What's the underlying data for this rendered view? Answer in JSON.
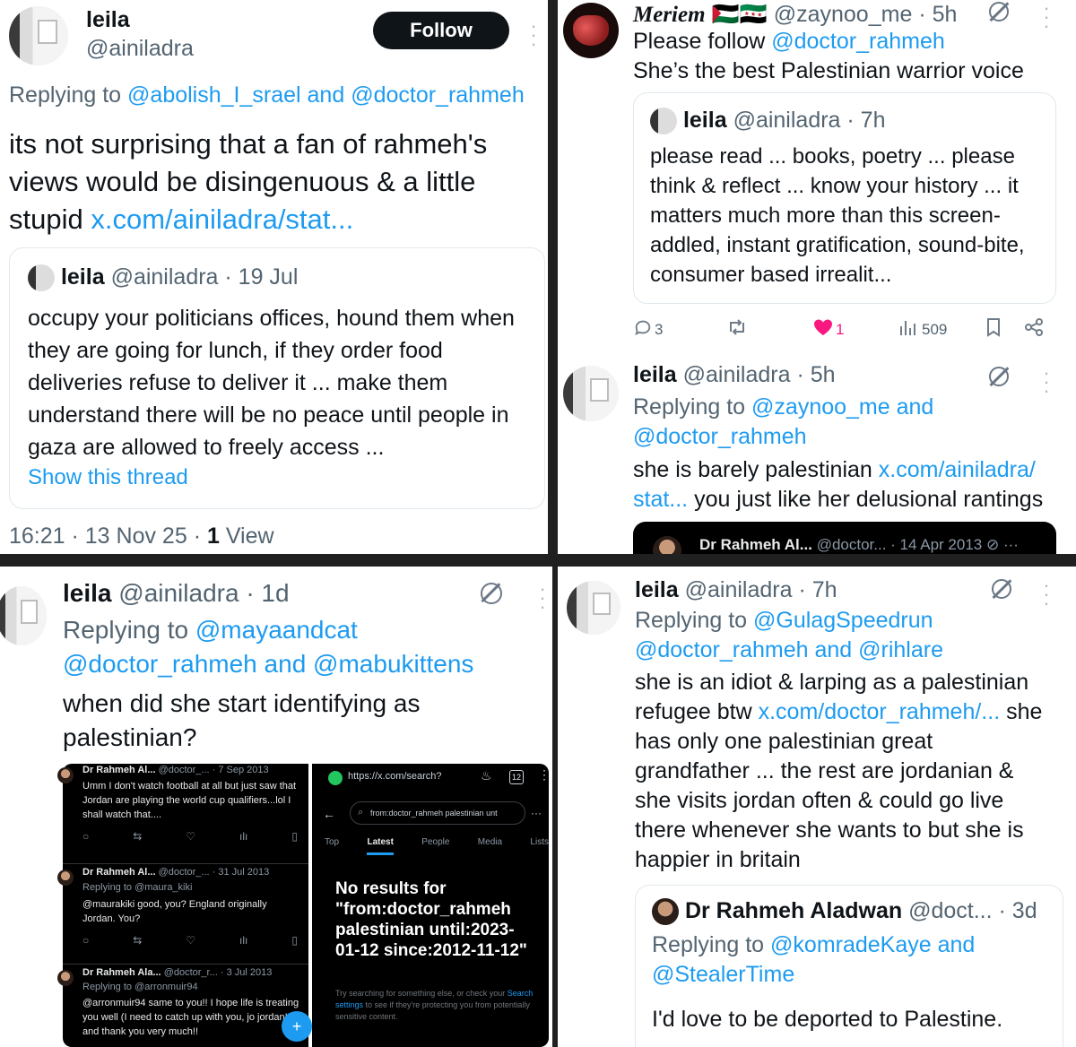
{
  "panel1": {
    "author_name": "leila",
    "author_handle": "@ainiladra",
    "follow_label": "Follow",
    "reply_prefix": "Replying to ",
    "reply_to_1": "@abolish_I_srael",
    "reply_and": " and ",
    "reply_to_2": "@doctor_rahmeh",
    "body": "its not surprising that a fan of rahmeh's views would be disingenuous & a little stupid ",
    "body_link": "x.com/ainiladra/stat...",
    "quote": {
      "author_name": "leila",
      "author_handle": "@ainiladra",
      "date": "· 19 Jul",
      "text": "occupy your politicians offices, hound them when they are going for lunch, if they order food deliveries refuse to deliver it ... make them understand there will be no peace until people in gaza are allowed to freely access ...",
      "show_thread": "Show this thread"
    },
    "timestamp": "16:21 · 13 Nov 25 · ",
    "view_count": "1",
    "view_label": " View"
  },
  "panel2": {
    "author_name": "Meriem",
    "flags": "🇵🇸🇸🇾",
    "author_handle": "@zaynoo_me",
    "time": "· 5h",
    "line1_prefix": "Please follow ",
    "line1_mention": "@doctor_rahmeh",
    "line2": "She’s the best Palestinian warrior voice",
    "quote": {
      "author_name": "leila",
      "author_handle": "@ainiladra",
      "time": "· 7h",
      "text": "please read ... books, poetry ... please think & reflect ... know your history ... it matters much more than this screen-addled, instant gratification, sound-bite, consumer based irrealit..."
    },
    "actions": {
      "replies": "3",
      "likes": "1",
      "views": "509"
    },
    "reply": {
      "author_name": "leila",
      "author_handle": "@ainiladra",
      "time": "· 5h",
      "reply_prefix": "Replying to ",
      "reply_to_1": "@zaynoo_me",
      "reply_and": " and",
      "reply_to_2": "@doctor_rahmeh",
      "text": "she is barely palestinian ",
      "link1": "x.com/ainiladra/",
      "link2": "stat...",
      "text2": " you just like her delusional rantings"
    },
    "embedded": {
      "name": "Dr Rahmeh Al...",
      "handle": "@doctor...",
      "date": "· 14 Apr 2013"
    }
  },
  "panel3": {
    "author_name": "leila",
    "author_handle": "@ainiladra",
    "time": "· 1d",
    "reply_prefix": "Replying to ",
    "reply_to_1": "@mayaandcat",
    "reply_to_2": "@doctor_rahmeh",
    "reply_and": " and ",
    "reply_to_3": "@mabukittens",
    "text": "when did she start identifying as palestinian?",
    "shot_left": [
      {
        "name": "Dr Rahmeh Al...",
        "handle": "@doctor_...",
        "date": "· 7 Sep 2013",
        "reply_to": "",
        "text": "Umm I don't watch football at all but just saw that Jordan are playing the world cup qualifiers...lol I shall watch that...."
      },
      {
        "name": "Dr Rahmeh Al...",
        "handle": "@doctor_...",
        "date": "· 31 Jul 2013",
        "reply_to": "Replying to @maura_kiki",
        "text": "@maurakiki good, you? England originally Jordan. You?"
      },
      {
        "name": "Dr Rahmeh Ala...",
        "handle": "@doctor_r...",
        "date": "· 3 Jul 2013",
        "reply_to": "Replying to @arronmuir94",
        "text": "@arronmuir94 same to you!! I hope life is treating you well (I need to catch up with you, jo jordan!!) and thank you very much!!"
      }
    ],
    "shot_right": {
      "url": "https://x.com/search?",
      "tab_count": "12",
      "search_query": "from:doctor_rahmeh palestinian unt",
      "tabs": [
        "Top",
        "Latest",
        "People",
        "Media",
        "Lists"
      ],
      "no_results": "No results for \"from:doctor_rahmeh palestinian until:2023-01-12 since:2012-11-12\"",
      "hint_prefix": "Try searching for something else, or check your ",
      "hint_link": "Search settings",
      "hint_suffix": " to see if they're protecting you from potentially sensitive content."
    }
  },
  "panel4": {
    "author_name": "leila",
    "author_handle": "@ainiladra",
    "time": "· 7h",
    "reply_prefix": "Replying to ",
    "reply_to_1": "@GulagSpeedrun",
    "reply_to_2": "@doctor_rahmeh",
    "reply_and": " and ",
    "reply_to_3": "@rihlare",
    "text_a": "she is an idiot & larping as a palestinian refugee btw ",
    "link": "x.com/doctor_rahmeh/...",
    "text_b": " she has only one palestinian great grandfather ... the rest are jordanian & she visits jordan often & could go live there whenever she wants to but she is happier in britain",
    "quote": {
      "author_name": "Dr Rahmeh Aladwan",
      "author_handle": "@doct...",
      "time": "· 3d",
      "reply_prefix": "Replying to ",
      "reply_to_1": "@komradeKaye",
      "reply_and": " and",
      "reply_to_2": "@StealerTime",
      "text": "I'd love to be deported to Palestine."
    }
  },
  "colors": {
    "accent": "#1d9bf0",
    "like": "#f91880",
    "text": "#0f1419",
    "muted": "#536471"
  }
}
